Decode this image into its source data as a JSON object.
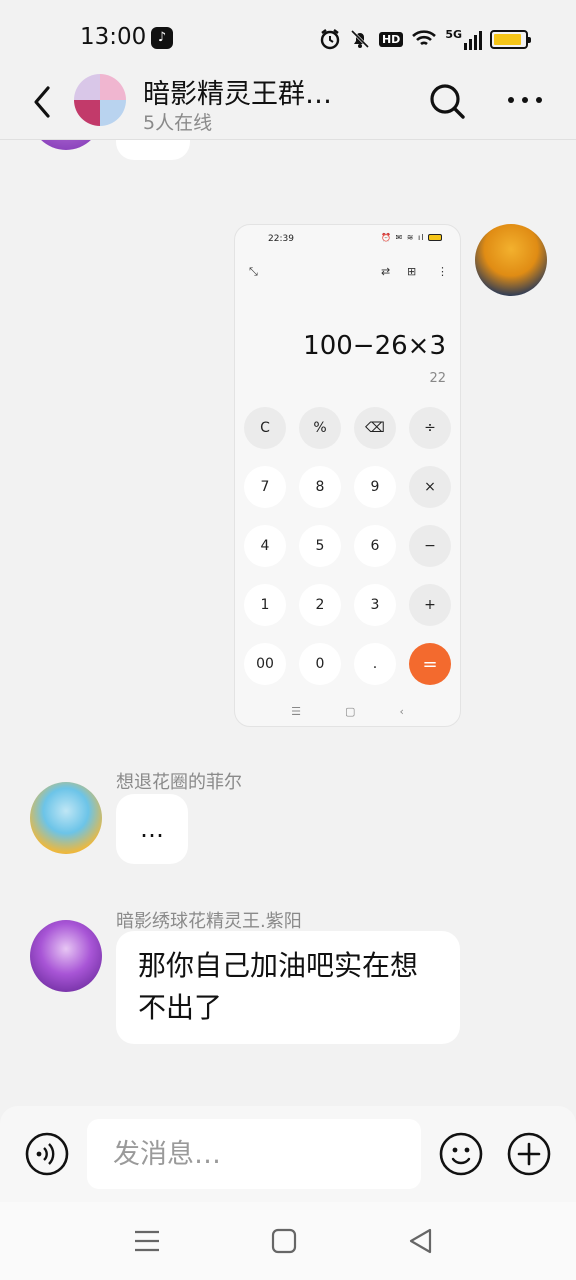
{
  "status_bar": {
    "time": "13:00",
    "app_icon": "tiktok-icon",
    "icons": [
      "alarm-icon",
      "mute-icon",
      "hd-icon",
      "wifi-icon",
      "5g-signal-icon",
      "battery-icon"
    ],
    "hd_label": "HD",
    "network_label": "5G",
    "battery_level": 0.9,
    "battery_color": "#f5c518"
  },
  "header": {
    "title": "暗影精灵王群…",
    "subtitle": "5人在线"
  },
  "messages": [
    {
      "type": "image",
      "side": "right",
      "calculator": {
        "time": "22:39",
        "expression": "100−26×3",
        "result": "22",
        "keys": [
          "C",
          "%",
          "⌫",
          "÷",
          "7",
          "8",
          "9",
          "×",
          "4",
          "5",
          "6",
          "−",
          "1",
          "2",
          "3",
          "+",
          "00",
          "0",
          ".",
          "="
        ],
        "accent": "#f36a2e"
      }
    },
    {
      "type": "text",
      "side": "left",
      "sender": "想退花圈的菲尔",
      "text": "…"
    },
    {
      "type": "text",
      "side": "left",
      "sender": "暗影绣球花精灵王.紫阳",
      "text": "那你自己加油吧实在想不出了"
    }
  ],
  "input": {
    "placeholder": "发消息…"
  },
  "nav_bar": {
    "buttons": [
      "menu-icon",
      "home-icon",
      "back-icon"
    ]
  }
}
